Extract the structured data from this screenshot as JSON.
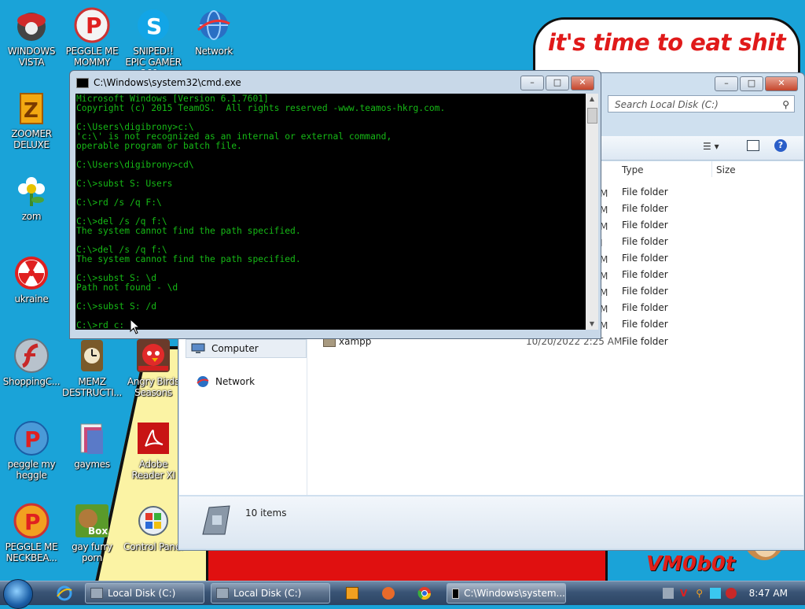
{
  "wallpaper": {
    "speech_text": "it's time to eat shit",
    "watermark": "VM0b0t"
  },
  "desktop_icons": [
    {
      "label": "WINDOWS VISTA"
    },
    {
      "label": "PEGGLE ME MOMMY"
    },
    {
      "label": "SNIPED!! EPIC GAMER 360..."
    },
    {
      "label": "Network"
    },
    {
      "label": "ZOOMER DELUXE"
    },
    {
      "label": "zom"
    },
    {
      "label": "ukraine"
    },
    {
      "label": "ShoppingC..."
    },
    {
      "label": "MEMZ DESTRUCTI..."
    },
    {
      "label": "Angry Birds Seasons"
    },
    {
      "label": "peggle my heggle"
    },
    {
      "label": "gaymes"
    },
    {
      "label": "Adobe Reader XI"
    },
    {
      "label": "PEGGLE ME NECKBEA..."
    },
    {
      "label": "gay furry porn"
    },
    {
      "label": "Control Panel"
    }
  ],
  "explorer": {
    "search_placeholder": "Search Local Disk (C:)",
    "col_type": "Type",
    "col_size": "Size",
    "rows": [
      {
        "name": "",
        "date": "M",
        "type": "File folder"
      },
      {
        "name": "",
        "date": "M",
        "type": "File folder"
      },
      {
        "name": "",
        "date": "M",
        "type": "File folder"
      },
      {
        "name": "",
        "date": "I",
        "type": "File folder"
      },
      {
        "name": "",
        "date": "M",
        "type": "File folder"
      },
      {
        "name": "",
        "date": "M",
        "type": "File folder"
      },
      {
        "name": "",
        "date": "M",
        "type": "File folder"
      },
      {
        "name": "",
        "date": "M",
        "type": "File folder"
      },
      {
        "name": "",
        "date": "M",
        "type": "File folder"
      },
      {
        "name": "xampp",
        "date": "10/20/2022 2:25 AM",
        "type": "File folder"
      }
    ],
    "nav_computer": "Computer",
    "nav_network": "Network",
    "status": "10 items"
  },
  "cmd": {
    "title": "C:\\Windows\\system32\\cmd.exe",
    "output": "Microsoft Windows [Version 6.1.7601]\nCopyright (c) 2015 TeamOS.  All rights reserved -www.teamos-hkrg.com.\n\nC:\\Users\\digibrony>c:\\\n'c:\\' is not recognized as an internal or external command,\noperable program or batch file.\n\nC:\\Users\\digibrony>cd\\\n\nC:\\>subst S: Users\n\nC:\\>rd /s /q F:\\\n\nC:\\>del /s /q f:\\\nThe system cannot find the path specified.\n\nC:\\>del /s /q f:\\\nThe system cannot find the path specified.\n\nC:\\>subst S: \\d\nPath not found - \\d\n\nC:\\>subst S: /d\n\nC:\\>rd c:"
  },
  "taskbar": {
    "buttons": [
      {
        "label": "Local Disk (C:)"
      },
      {
        "label": "Local Disk (C:)"
      },
      {
        "label": "C:\\Windows\\system..."
      }
    ],
    "clock": "8:47 AM"
  }
}
